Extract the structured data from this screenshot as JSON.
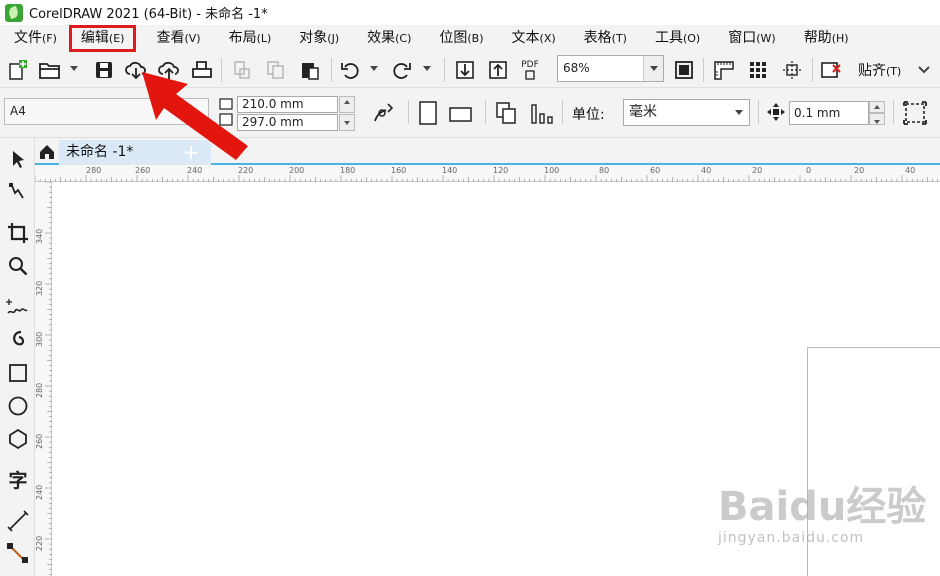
{
  "window": {
    "title": "CorelDRAW 2021 (64-Bit) - 未命名 -1*"
  },
  "menu": {
    "items": [
      {
        "label": "文件",
        "accel": "(F)"
      },
      {
        "label": "编辑",
        "accel": "(E)"
      },
      {
        "label": "查看",
        "accel": "(V)"
      },
      {
        "label": "布局",
        "accel": "(L)"
      },
      {
        "label": "对象",
        "accel": "(J)"
      },
      {
        "label": "效果",
        "accel": "(C)"
      },
      {
        "label": "位图",
        "accel": "(B)"
      },
      {
        "label": "文本",
        "accel": "(X)"
      },
      {
        "label": "表格",
        "accel": "(T)"
      },
      {
        "label": "工具",
        "accel": "(O)"
      },
      {
        "label": "窗口",
        "accel": "(W)"
      },
      {
        "label": "帮助",
        "accel": "(H)"
      }
    ]
  },
  "toolbar": {
    "zoom_value": "68%",
    "pdf_label": "PDF",
    "snap_label": "贴齐",
    "snap_accel": "(T)"
  },
  "propertybar": {
    "page_size": "A4",
    "width": "210.0 mm",
    "height": "297.0 mm",
    "unit_label": "单位:",
    "unit_value": "毫米",
    "nudge_value": "0.1 mm"
  },
  "tools": {
    "text_tool_glyph": "字"
  },
  "document": {
    "tab_label": "未命名 -1*",
    "add_tab_glyph": "+"
  },
  "rulers": {
    "horizontal": [
      "280",
      "260",
      "240",
      "220",
      "200",
      "180",
      "160",
      "140",
      "120",
      "100",
      "80",
      "60",
      "40",
      "20",
      "0",
      "20",
      "40"
    ],
    "vertical": [
      "340",
      "320",
      "300",
      "280",
      "260",
      "240",
      "220"
    ]
  },
  "watermark": {
    "main": "Baidu经验",
    "sub": "jingyan.baidu.com"
  },
  "colors": {
    "highlight": "#e01b1b",
    "tab_accent": "#49b3e4",
    "app_green": "#3aa535"
  }
}
